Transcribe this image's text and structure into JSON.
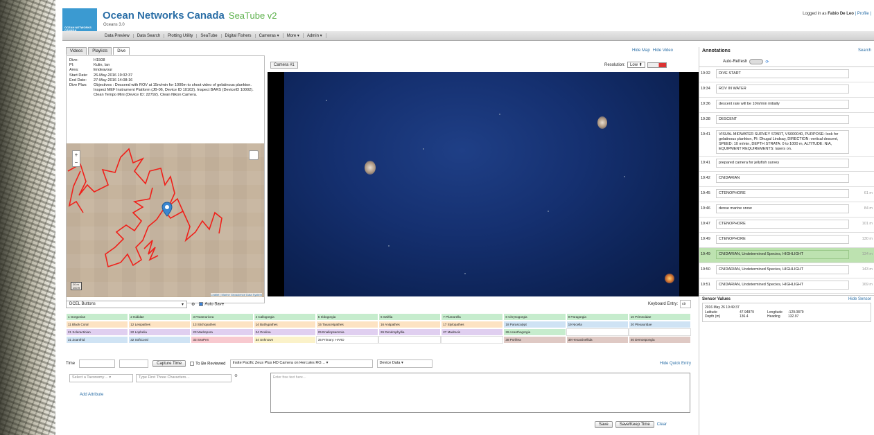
{
  "header": {
    "logo_text": "OCEAN NETWORKS CANADA",
    "brand": "Ocean Networks Canada",
    "app_name": "SeaTube v2",
    "version": "Oceans 3.0",
    "login_prefix": "Logged in as",
    "user": "Fabio De Leo",
    "profile": "| Profile |"
  },
  "menu": [
    "Data Preview",
    "Data Search",
    "Plotting Utility",
    "SeaTube",
    "Digital Fishers",
    "Cameras ▾",
    "More ▾",
    "Admin ▾"
  ],
  "tabs": [
    "Videos",
    "Playlists",
    "Dive"
  ],
  "dive": [
    {
      "k": "Dive:",
      "v": "H1508"
    },
    {
      "k": "PI:",
      "v": "Kulin, Ian"
    },
    {
      "k": "Area:",
      "v": "Endeavour"
    },
    {
      "k": "Start Date:",
      "v": "26-May-2016 19:32:37"
    },
    {
      "k": "End Date:",
      "v": "27-May-2016 14:08:16"
    },
    {
      "k": "Dive Plan:",
      "v": "Objectives : Descend with ROV at 15m/min for 1000m to shoot video of gelatinous plankton. Inspect MEF Instrument Platform (JB-06, Device ID 10102). Inspect BARS (DeviceID 10002). Clean Tempo Mini (Device ID: 22792). Clean Nikon Camera."
    }
  ],
  "map": {
    "scale1": "20 m",
    "scale2": "100 ft",
    "attribution": "Leaflet | Marine Geoscience Data System",
    "zoom_in": "+",
    "zoom_out": "−"
  },
  "links": {
    "hide_map": "Hide Map",
    "hide_video": "Hide Video"
  },
  "camera": {
    "tab": "Camera #1",
    "resolution_label": "Resolution:",
    "resolution": "Low ⬍"
  },
  "quick": {
    "button_set": "DCEL Buttons",
    "autosave": "Auto Save",
    "keyboard_entry": "Keyboard Entry:",
    "keyboard_value": "ctr"
  },
  "buttons": [
    {
      "t": "1 Gorgonian",
      "c": "green"
    },
    {
      "t": "2 Isididae",
      "c": "green"
    },
    {
      "t": "3 Paramuricea",
      "c": "green"
    },
    {
      "t": "4 Callogorgia",
      "c": "green"
    },
    {
      "t": "5 Iridogorgia",
      "c": "green"
    },
    {
      "t": "6 Swiftia",
      "c": "green"
    },
    {
      "t": "7 Plumarella",
      "c": "green"
    },
    {
      "t": "8 Chrysogorgia",
      "c": "green"
    },
    {
      "t": "9 Paragorgia",
      "c": "green"
    },
    {
      "t": "10 Primnoidae",
      "c": "green"
    },
    {
      "t": "11 Black Coral",
      "c": "orange"
    },
    {
      "t": "12 Leiopathes",
      "c": "orange"
    },
    {
      "t": "13 Stichopathes",
      "c": "orange"
    },
    {
      "t": "14 Bathypathes",
      "c": "orange"
    },
    {
      "t": "15 Taxacetipathes",
      "c": "orange"
    },
    {
      "t": "16 Antipathes",
      "c": "orange"
    },
    {
      "t": "17 Stylopathes",
      "c": "orange"
    },
    {
      "t": "18 Parascalypt",
      "c": "blue"
    },
    {
      "t": "19 Nicella",
      "c": "blue"
    },
    {
      "t": "20 Plexauridae",
      "c": "blue"
    },
    {
      "t": "21 Scleractinian",
      "c": "purple"
    },
    {
      "t": "22 Lophelia",
      "c": "purple"
    },
    {
      "t": "23 Madrepora",
      "c": "purple"
    },
    {
      "t": "24 Oculina",
      "c": "purple"
    },
    {
      "t": "25 Enallopsammia",
      "c": "purple"
    },
    {
      "t": "26 Dendrophyllia",
      "c": "purple"
    },
    {
      "t": "27 Madracis",
      "c": "purple"
    },
    {
      "t": "28 Acanthogorgia",
      "c": "green"
    },
    {
      "t": "",
      "c": "white"
    },
    {
      "t": "",
      "c": "white"
    },
    {
      "t": "31 Zoanthid",
      "c": "blue"
    },
    {
      "t": "32 SoftCoral",
      "c": "blue"
    },
    {
      "t": "33 SeaPen",
      "c": "pink"
    },
    {
      "t": "34 Unknown",
      "c": "yellow"
    },
    {
      "t": "35 Primary: HARD",
      "c": "white"
    },
    {
      "t": "",
      "c": "white"
    },
    {
      "t": "",
      "c": "white"
    },
    {
      "t": "38 Porifera",
      "c": "brown"
    },
    {
      "t": "39 Hexactinellida",
      "c": "brown"
    },
    {
      "t": "40 Demospongia",
      "c": "brown"
    }
  ],
  "entry": {
    "time_label": "Time",
    "capture": "Capture Time",
    "to_review": "To Be Reviewed",
    "camera_select": "Insite Pacific Zeus Plus HD Camera on Hercules RO… ▾",
    "device_data": "Device Data ▾",
    "hide_quick": "Hide Quick Entry",
    "taxonomy": "Select a Taxonomy… ▾",
    "type_chars": "Type First Three Characters…",
    "add_attr": "Add Attribute",
    "free_text": "Enter free text here…",
    "save": "Save",
    "save_keep": "Save/Keep Time",
    "clear": "Clear"
  },
  "annotations": {
    "title": "Annotations",
    "search": "Search",
    "auto_refresh": "Auto-Refresh",
    "items": [
      {
        "t": "19:32",
        "d": "DIVE START",
        "m": "",
        "hl": false
      },
      {
        "t": "19:34",
        "d": "ROV IN WATER",
        "m": "",
        "hl": false
      },
      {
        "t": "19:36",
        "d": "descent rate will be 10m/min initially",
        "m": "",
        "hl": false
      },
      {
        "t": "19:38",
        "d": "DESCENT",
        "m": "",
        "hl": false
      },
      {
        "t": "19:41",
        "d": "VISUAL MIDWATER SURVEY START, VS000040, PURPOSE: look for gelatinous plankton, PI: Dhugal Lindsay, DIRECTION: vertical descent, SPEED: 10 m/min, DEPTH STRATA: 0 to 1000 m, ALTITUDE: N/A, EQUIPMENT REQUIREMENTS: lasers on.",
        "m": "",
        "hl": false
      },
      {
        "t": "19:41",
        "d": "prepared camera for jellyfish survey",
        "m": "",
        "hl": false
      },
      {
        "t": "19:42",
        "d": "CNIDARIAN",
        "m": "",
        "hl": false
      },
      {
        "t": "19:45",
        "d": "CTENOPHORE",
        "m": "61 m",
        "hl": false
      },
      {
        "t": "19:46",
        "d": "dense marine snow",
        "m": "84 m",
        "hl": false
      },
      {
        "t": "19:47",
        "d": "CTENOPHORE",
        "m": "101 m",
        "hl": false
      },
      {
        "t": "19:49",
        "d": "CTENOPHORE",
        "m": "130 m",
        "hl": false
      },
      {
        "t": "19:49",
        "d": "CNIDARIAN, Undetermined Species, HIGHLIGHT",
        "m": "134 m",
        "hl": true
      },
      {
        "t": "19:50",
        "d": "CNIDARIAN, Undetermined Species, HIGHLIGHT",
        "m": "143 m",
        "hl": false
      },
      {
        "t": "19:51",
        "d": "CNIDARIAN, Undetermined Species, HIGHLIGHT",
        "m": "169 m",
        "hl": false
      }
    ]
  },
  "sensor": {
    "title": "Sensor Values",
    "hide": "Hide Sensor",
    "timestamp": "2016 May 26 19:49:37",
    "lat_label": "Latitude",
    "lat": "47.94879",
    "lon_label": "Longitude",
    "lon": "-129.0879",
    "depth_label": "Depth (m)",
    "depth": "136.4",
    "heading_label": "Heading",
    "heading": "132.97"
  }
}
